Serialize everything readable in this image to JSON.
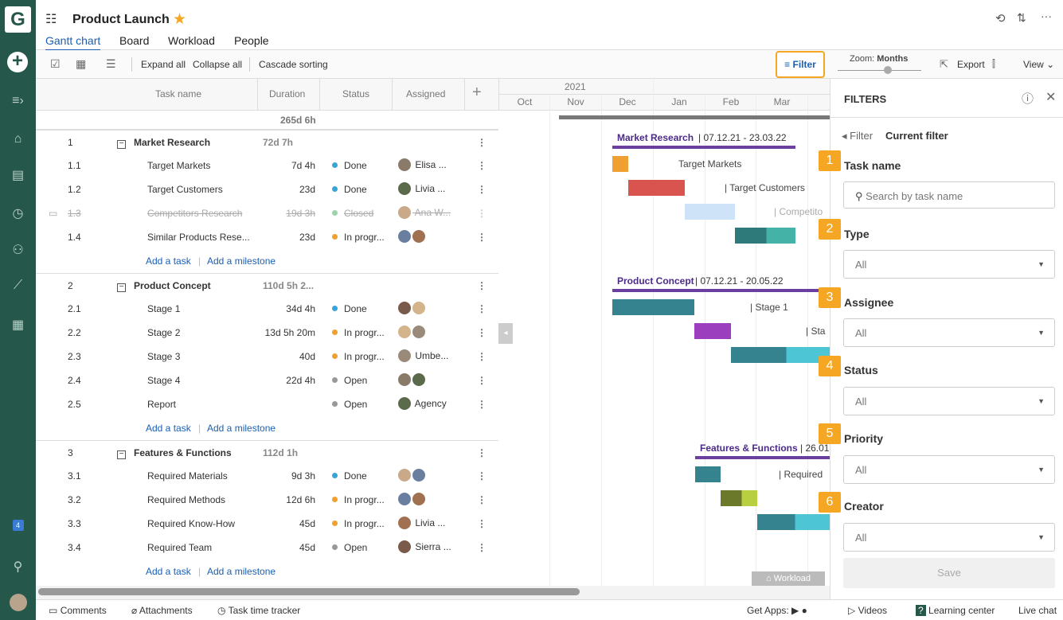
{
  "app": {
    "logo": "G",
    "title": "Product Launch"
  },
  "tabs": [
    "Gantt chart",
    "Board",
    "Workload",
    "People"
  ],
  "toolbar": {
    "expand_all": "Expand all",
    "collapse_all": "Collapse all",
    "cascade_sorting": "Cascade sorting",
    "filter": "Filter",
    "zoom_label": "Zoom:",
    "zoom_value": "Months",
    "export": "Export",
    "view": "View"
  },
  "grid": {
    "headers": {
      "task_name": "Task name",
      "duration": "Duration",
      "status": "Status",
      "assigned": "Assigned"
    },
    "total_duration": "265d 6h",
    "add_task": "Add a task",
    "add_milestone": "Add a milestone"
  },
  "groups": [
    {
      "num": "1",
      "name": "Market Research",
      "duration": "72d 7h",
      "tasks": [
        {
          "num": "1.1",
          "name": "Target Markets",
          "duration": "7d 4h",
          "status": "Done",
          "status_color": "#3aa4d8",
          "assignee": "Elisa ..."
        },
        {
          "num": "1.2",
          "name": "Target Customers",
          "duration": "23d",
          "status": "Done",
          "status_color": "#3aa4d8",
          "assignee": "Livia ..."
        },
        {
          "num": "1.3",
          "name": "Competitors Research",
          "duration": "19d 3h",
          "status": "Closed",
          "status_color": "#9bd3ad",
          "assignee": "Ana W..."
        },
        {
          "num": "1.4",
          "name": "Similar Products Rese...",
          "duration": "23d",
          "status": "In progr...",
          "status_color": "#f0a030",
          "assignee": ""
        }
      ]
    },
    {
      "num": "2",
      "name": "Product Concept",
      "duration": "110d 5h 2...",
      "tasks": [
        {
          "num": "2.1",
          "name": "Stage 1",
          "duration": "34d 4h",
          "status": "Done",
          "status_color": "#3aa4d8",
          "assignee": ""
        },
        {
          "num": "2.2",
          "name": "Stage 2",
          "duration": "13d 5h 20m",
          "status": "In progr...",
          "status_color": "#f0a030",
          "assignee": ""
        },
        {
          "num": "2.3",
          "name": "Stage 3",
          "duration": "40d",
          "status": "In progr...",
          "status_color": "#f0a030",
          "assignee": "Umbe..."
        },
        {
          "num": "2.4",
          "name": "Stage 4",
          "duration": "22d 4h",
          "status": "Open",
          "status_color": "#999999",
          "assignee": ""
        },
        {
          "num": "2.5",
          "name": "Report",
          "duration": "",
          "status": "Open",
          "status_color": "#999999",
          "assignee": "Agency"
        }
      ]
    },
    {
      "num": "3",
      "name": "Features & Functions",
      "duration": "112d 1h",
      "tasks": [
        {
          "num": "3.1",
          "name": "Required Materials",
          "duration": "9d 3h",
          "status": "Done",
          "status_color": "#3aa4d8",
          "assignee": ""
        },
        {
          "num": "3.2",
          "name": "Required Methods",
          "duration": "12d 6h",
          "status": "In progr...",
          "status_color": "#f0a030",
          "assignee": ""
        },
        {
          "num": "3.3",
          "name": "Required Know-How",
          "duration": "45d",
          "status": "In progr...",
          "status_color": "#f0a030",
          "assignee": "Livia ..."
        },
        {
          "num": "3.4",
          "name": "Required Team",
          "duration": "45d",
          "status": "Open",
          "status_color": "#999999",
          "assignee": "Sierra ..."
        }
      ]
    }
  ],
  "gantt": {
    "year": "2021",
    "months": [
      "Oct",
      "Nov",
      "Dec",
      "Jan",
      "Feb",
      "Mar"
    ],
    "labels": {
      "market_research": "Market Research",
      "market_research_dates": "07.12.21 - 23.03.22",
      "product_concept": "Product Concept",
      "product_concept_dates": "07.12.21 - 20.05.22",
      "features_functions": "Features & Functions",
      "features_functions_date": "26.01",
      "target_markets": "Target Markets",
      "target_customers": "Target Customers",
      "competitors": "Competito",
      "stage1": "Stage 1",
      "stage_trunc": "Sta",
      "required": "Required",
      "workload": "Workload"
    }
  },
  "filters": {
    "title": "FILTERS",
    "breadcrumb_back": "Filter",
    "breadcrumb_current": "Current filter",
    "task_name_label": "Task name",
    "search_placeholder": "Search by task name",
    "type_label": "Type",
    "assignee_label": "Assignee",
    "status_label": "Status",
    "priority_label": "Priority",
    "creator_label": "Creator",
    "all": "All",
    "save": "Save",
    "badges": [
      "1",
      "2",
      "3",
      "4",
      "5",
      "6"
    ]
  },
  "leftnav": {
    "notification_count": "4"
  },
  "footer": {
    "comments": "Comments",
    "attachments": "Attachments",
    "time_tracker": "Task time tracker",
    "get_apps": "Get Apps:",
    "videos": "Videos",
    "learning_center": "Learning center",
    "live_chat": "Live chat"
  }
}
